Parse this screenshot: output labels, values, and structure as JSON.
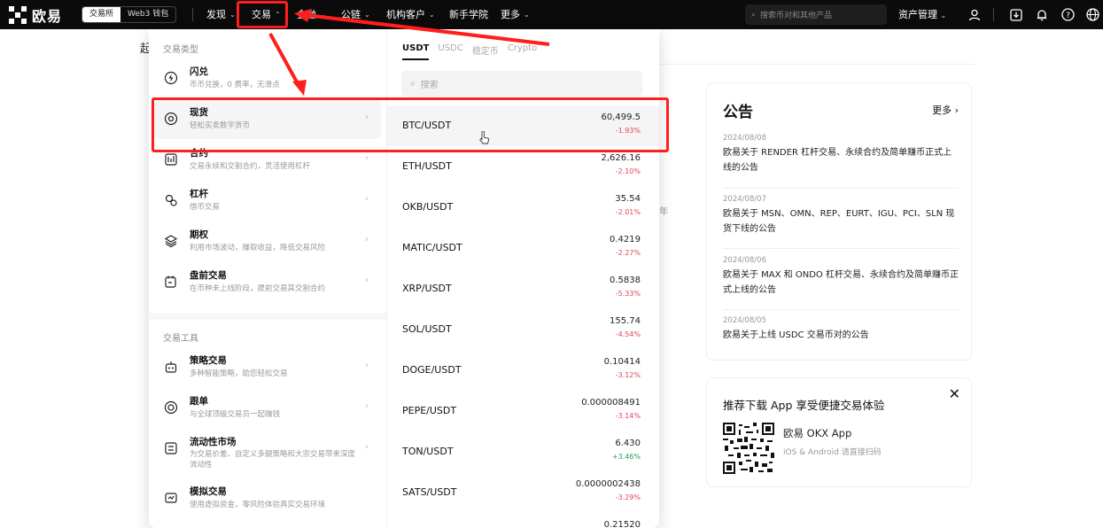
{
  "topbar": {
    "logo_text": "欧易",
    "mode_exchange": "交易所",
    "mode_web3": "Web3 钱包",
    "nav": [
      "发现",
      "交易",
      "金融",
      "公链",
      "机构客户",
      "新手学院",
      "更多"
    ],
    "search_placeholder": "搜索币对和其他产品",
    "assets_label": "资产管理"
  },
  "trade_menu": {
    "type_section_title": "交易类型",
    "tools_section_title": "交易工具",
    "types": [
      {
        "title": "闪兑",
        "desc": "币币兑换，0 费率，无滑点"
      },
      {
        "title": "现货",
        "desc": "轻松买卖数字货币"
      },
      {
        "title": "合约",
        "desc": "交易永续和交割合约，灵活使用杠杆"
      },
      {
        "title": "杠杆",
        "desc": "借币交易"
      },
      {
        "title": "期权",
        "desc": "利用市场波动，赚取收益，降低交易风险"
      },
      {
        "title": "盘前交易",
        "desc": "在币种未上线阶段，提前交易其交割合约"
      }
    ],
    "tools": [
      {
        "title": "策略交易",
        "desc": "多种智能策略，助您轻松交易"
      },
      {
        "title": "跟单",
        "desc": "与全球顶级交易员一起赚钱"
      },
      {
        "title": "流动性市场",
        "desc": "为交易价差、自定义多腿策略和大宗交易带来深度流动性"
      },
      {
        "title": "模拟交易",
        "desc": "使用虚拟资金，零风险体验真实交易环境"
      }
    ]
  },
  "pairs_panel": {
    "tabs": [
      "USDT",
      "USDC",
      "稳定币",
      "Crypto"
    ],
    "search_placeholder": "搜索",
    "pairs": [
      {
        "name": "BTC/USDT",
        "price": "60,499.5",
        "change": "-1.93%"
      },
      {
        "name": "ETH/USDT",
        "price": "2,626.16",
        "change": "-2.10%"
      },
      {
        "name": "OKB/USDT",
        "price": "35.54",
        "change": "-2.01%"
      },
      {
        "name": "MATIC/USDT",
        "price": "0.4219",
        "change": "-2.27%"
      },
      {
        "name": "XRP/USDT",
        "price": "0.5838",
        "change": "-5.33%"
      },
      {
        "name": "SOL/USDT",
        "price": "155.74",
        "change": "-4.54%"
      },
      {
        "name": "DOGE/USDT",
        "price": "0.10414",
        "change": "-3.12%"
      },
      {
        "name": "PEPE/USDT",
        "price": "0.000008491",
        "change": "-3.14%"
      },
      {
        "name": "TON/USDT",
        "price": "6.430",
        "change": "+3.46%"
      },
      {
        "name": "SATS/USDT",
        "price": "0.0000002438",
        "change": "-3.29%"
      },
      {
        "name": "",
        "price": "0.21520",
        "change": ""
      }
    ]
  },
  "background": {
    "left_partial_char": "起",
    "mid_partial_char": "年"
  },
  "announcements": {
    "title": "公告",
    "more": "更多",
    "items": [
      {
        "date": "2024/08/08",
        "text": "欧易关于 RENDER 杠杆交易、永续合约及简单赚币正式上线的公告"
      },
      {
        "date": "2024/08/07",
        "text": "欧易关于 MSN、OMN、REP、EURT、IGU、PCI、SLN 现货下线的公告"
      },
      {
        "date": "2024/08/06",
        "text": "欧易关于 MAX 和 ONDO 杠杆交易、永续合约及简单赚币正式上线的公告"
      },
      {
        "date": "2024/08/05",
        "text": "欧易关于上线 USDC 交易币对的公告"
      }
    ]
  },
  "app_promo": {
    "title": "推荐下载 App 享受便捷交易体验",
    "app_name": "欧易 OKX App",
    "platforms": "iOS & Android 请直接扫码"
  },
  "colors": {
    "highlight": "#ff1e1e",
    "down": "#e0445c",
    "up": "#1fa05c"
  }
}
